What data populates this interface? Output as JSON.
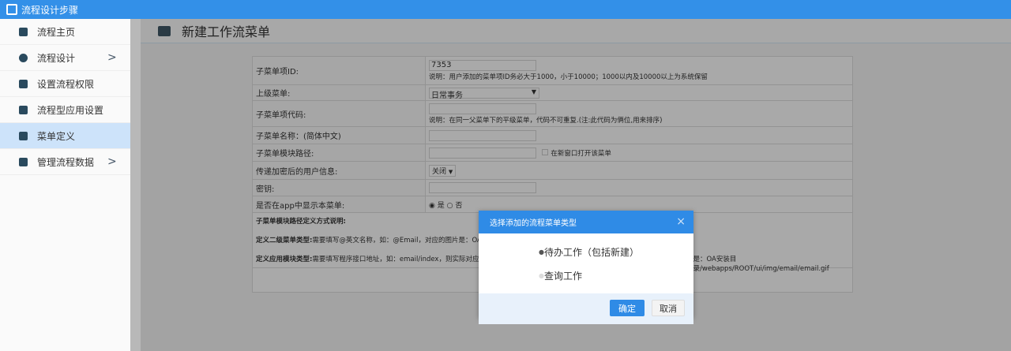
{
  "app": {
    "title": "流程设计步骤"
  },
  "sidebar": {
    "items": [
      {
        "label": "流程主页"
      },
      {
        "label": "流程设计",
        "chevron": ">"
      },
      {
        "label": "设置流程权限"
      },
      {
        "label": "流程型应用设置"
      },
      {
        "label": "菜单定义",
        "active": true
      },
      {
        "label": "管理流程数据",
        "chevron": ">"
      }
    ]
  },
  "page": {
    "title": "新建工作流菜单"
  },
  "form": {
    "id_label": "子菜单项ID:",
    "id_value": "7353",
    "id_note": "说明：用户添加的菜单项ID务必大于1000，小于10000；1000以内及10000以上为系统保留",
    "parent_label": "上级菜单:",
    "parent_value": "日常事务",
    "code_label": "子菜单项代码:",
    "code_note": "说明：在同一父菜单下的平级菜单，代码不可重复.(注:此代码为俩位,用来排序)",
    "name_label": "子菜单名称：(简体中文)",
    "path_label": "子菜单模块路径:",
    "newwin_label": "在新窗口打开该菜单",
    "encrypt_label": "传递加密后的用户信息:",
    "encrypt_value": "关闭",
    "key_label": "密钥:",
    "app_label": "是否在app中显示本菜单:",
    "app_yes": "是",
    "app_no": "否",
    "notes_title": "子菜单模块路径定义方式说明:",
    "note1_title": "定义二级菜单类型:",
    "note1_text": "需要填写@英文名称，如：@Email，对应的图片是：OA",
    "note2_title": "定义应用模块类型:",
    "note2_text": "需要填写程序接口地址，如：email/index，则实际对应的",
    "note2_tail": "是：OA安装目录/webapps/ROOT/ui/img/email/email.gif"
  },
  "modal": {
    "title": "选择添加的流程菜单类型",
    "close": "×",
    "options": [
      {
        "label": "待办工作（包括新建）",
        "checked": true
      },
      {
        "label": "查询工作",
        "checked": false
      }
    ],
    "ok": "确定",
    "cancel": "取消"
  }
}
